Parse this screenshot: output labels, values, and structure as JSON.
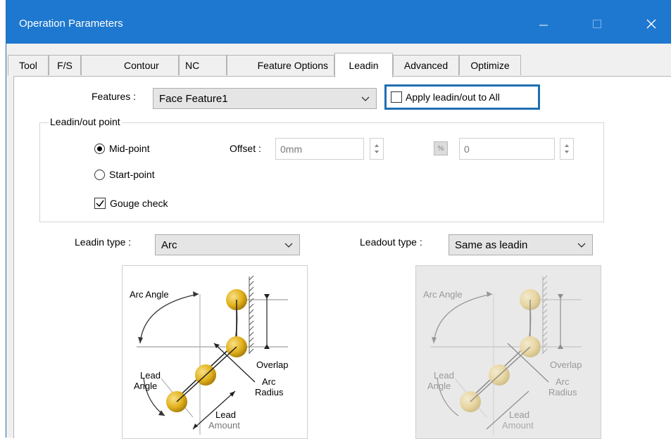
{
  "window": {
    "title": "Operation Parameters",
    "accent_color": "#1e78cf",
    "controls": [
      "minimize-icon",
      "maximize-icon",
      "close-icon"
    ]
  },
  "tabs": [
    {
      "label": "Tool",
      "active": false
    },
    {
      "label": "F/S",
      "active": false
    },
    {
      "label": "Contour",
      "active": false
    },
    {
      "label": "NC",
      "active": false
    },
    {
      "label": "Feature Options",
      "active": false
    },
    {
      "label": "Leadin",
      "active": true
    },
    {
      "label": "Advanced",
      "active": false
    },
    {
      "label": "Optimize",
      "active": false
    }
  ],
  "features": {
    "label": "Features :",
    "value": "Face Feature1"
  },
  "apply_all": {
    "label": "Apply leadin/out to All",
    "checked": false,
    "highlight_color": "#1f6fb2"
  },
  "leadin_point": {
    "group_title": "Leadin/out point",
    "mid_point": {
      "label": "Mid-point",
      "selected": true
    },
    "start_point": {
      "label": "Start-point",
      "selected": false
    },
    "gouge_check": {
      "label": "Gouge check",
      "checked": true
    },
    "offset": {
      "label": "Offset :",
      "value": "0mm"
    },
    "percent_icon": "%",
    "percent_value": "0"
  },
  "leadin_type": {
    "label": "Leadin type :",
    "value": "Arc"
  },
  "leadout_type": {
    "label": "Leadout type :",
    "value": "Same as leadin"
  },
  "diagram_labels": {
    "arc_angle": "Arc Angle",
    "overlap": "Overlap",
    "lead_angle_1": "Lead",
    "lead_angle_2": "Angle",
    "arc_radius_1": "Arc",
    "arc_radius_2": "Radius",
    "lead_amount_1": "Lead",
    "lead_amount_2": "Amount"
  },
  "colors": {
    "tool_ball": "#e2b21c",
    "diagram_disabled_bg": "#e9e9e9"
  }
}
